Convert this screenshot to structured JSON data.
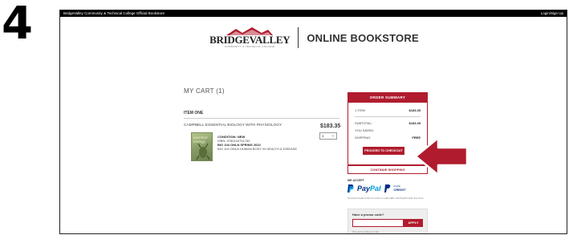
{
  "step_number": "4",
  "topbar": {
    "store_name": "BridgeValley Community & Technical College Official Bookstore",
    "login_label": "Login/Sign Up"
  },
  "header": {
    "logo_word": "BRIDGEVALLEY",
    "logo_sub": "COMMUNITY & TECHNICAL COLLEGE",
    "title": "ONLINE BOOKSTORE"
  },
  "cart": {
    "title": "MY CART (1)",
    "item_heading": "ITEM ONE",
    "product_name": "CAMPBELL ESSENTIAL BIOLOGY WITH PHYSIOLOGY",
    "price": "$183.35",
    "qty": "1",
    "book_cover_text": "essential biology",
    "condition": "CONDITION: NEW",
    "isbn": "ISBN: 9780134751750",
    "course": "BIO 104 ONLN SPRING 2022",
    "course_desc": "BIO 104 ONLN HUMAN BODY IN HEALTH & DISEASE"
  },
  "summary": {
    "heading": "ORDER SUMMARY",
    "items_label": "1 ITEM",
    "items_value": "$183.35",
    "subtotal_label": "SUBTOTAL:",
    "subtotal_value": "$183.35",
    "saved_label": "YOU SAVED:",
    "saved_value": "",
    "shipping_label": "SHIPPING:",
    "shipping_value": "FREE",
    "checkout_label": "PROCEED TO CHECKOUT",
    "continue_label": "CONTINUE SHOPPING"
  },
  "payment": {
    "we_accept": "WE ACCEPT",
    "paypal_dark": "Pay",
    "paypal_light": "Pal",
    "paypal_credit_top": "PayPal",
    "paypal_credit": "CREDIT",
    "fine_print": "No interest if paid in full in 6 months on orders $99+ with PayPal Credit. See terms."
  },
  "promo": {
    "heading": "Have a promo code?",
    "apply_label": "APPLY",
    "note": "One promo code per order."
  },
  "colors": {
    "accent": "#b01c2e",
    "paypal_dark": "#003087",
    "paypal_light": "#009cde"
  }
}
